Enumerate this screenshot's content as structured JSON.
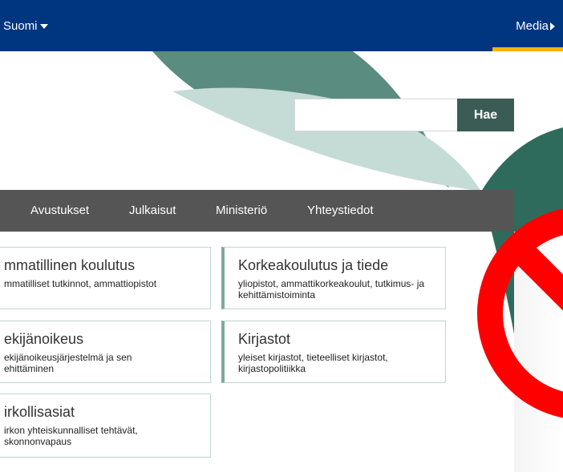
{
  "topbar": {
    "language_label": "Suomi",
    "media_label": "Media"
  },
  "search": {
    "placeholder": "",
    "value": "",
    "button_label": "Hae"
  },
  "nav": {
    "items": [
      {
        "label": "Avustukset"
      },
      {
        "label": "Julkaisut"
      },
      {
        "label": "Ministeriö"
      },
      {
        "label": "Yhteystiedot"
      }
    ]
  },
  "cards": [
    {
      "title": "mmatillinen koulutus",
      "desc": "mmatilliset tutkinnot, ammattiopistot"
    },
    {
      "title": "Korkeakoulutus ja tiede",
      "desc": "yliopistot, ammattikorkeakoulut, tutkimus- ja kehittämistoiminta"
    },
    {
      "title": "ekijänoikeus",
      "desc": "ekijänoikeusjärjestelmä ja sen ehittäminen"
    },
    {
      "title": "Kirjastot",
      "desc": "yleiset kirjastot, tieteelliset kirjastot, kirjastopolitiikka"
    },
    {
      "title": "irkollisasiat",
      "desc": "irkon yhteiskunnalliset tehtävät, skonnonvapaus"
    }
  ],
  "colors": {
    "topbar": "#003580",
    "accent_yellow": "#f4b400",
    "search_button": "#3b5c55",
    "nav_bg": "#555555",
    "leaf_dark": "#5a8c80",
    "leaf_light": "#c5dbd6",
    "ban_red": "#ff0000"
  },
  "icons": {
    "language_caret": "caret-down-icon",
    "media_arrow": "triangle-right-icon",
    "overlay": "prohibition-icon"
  }
}
